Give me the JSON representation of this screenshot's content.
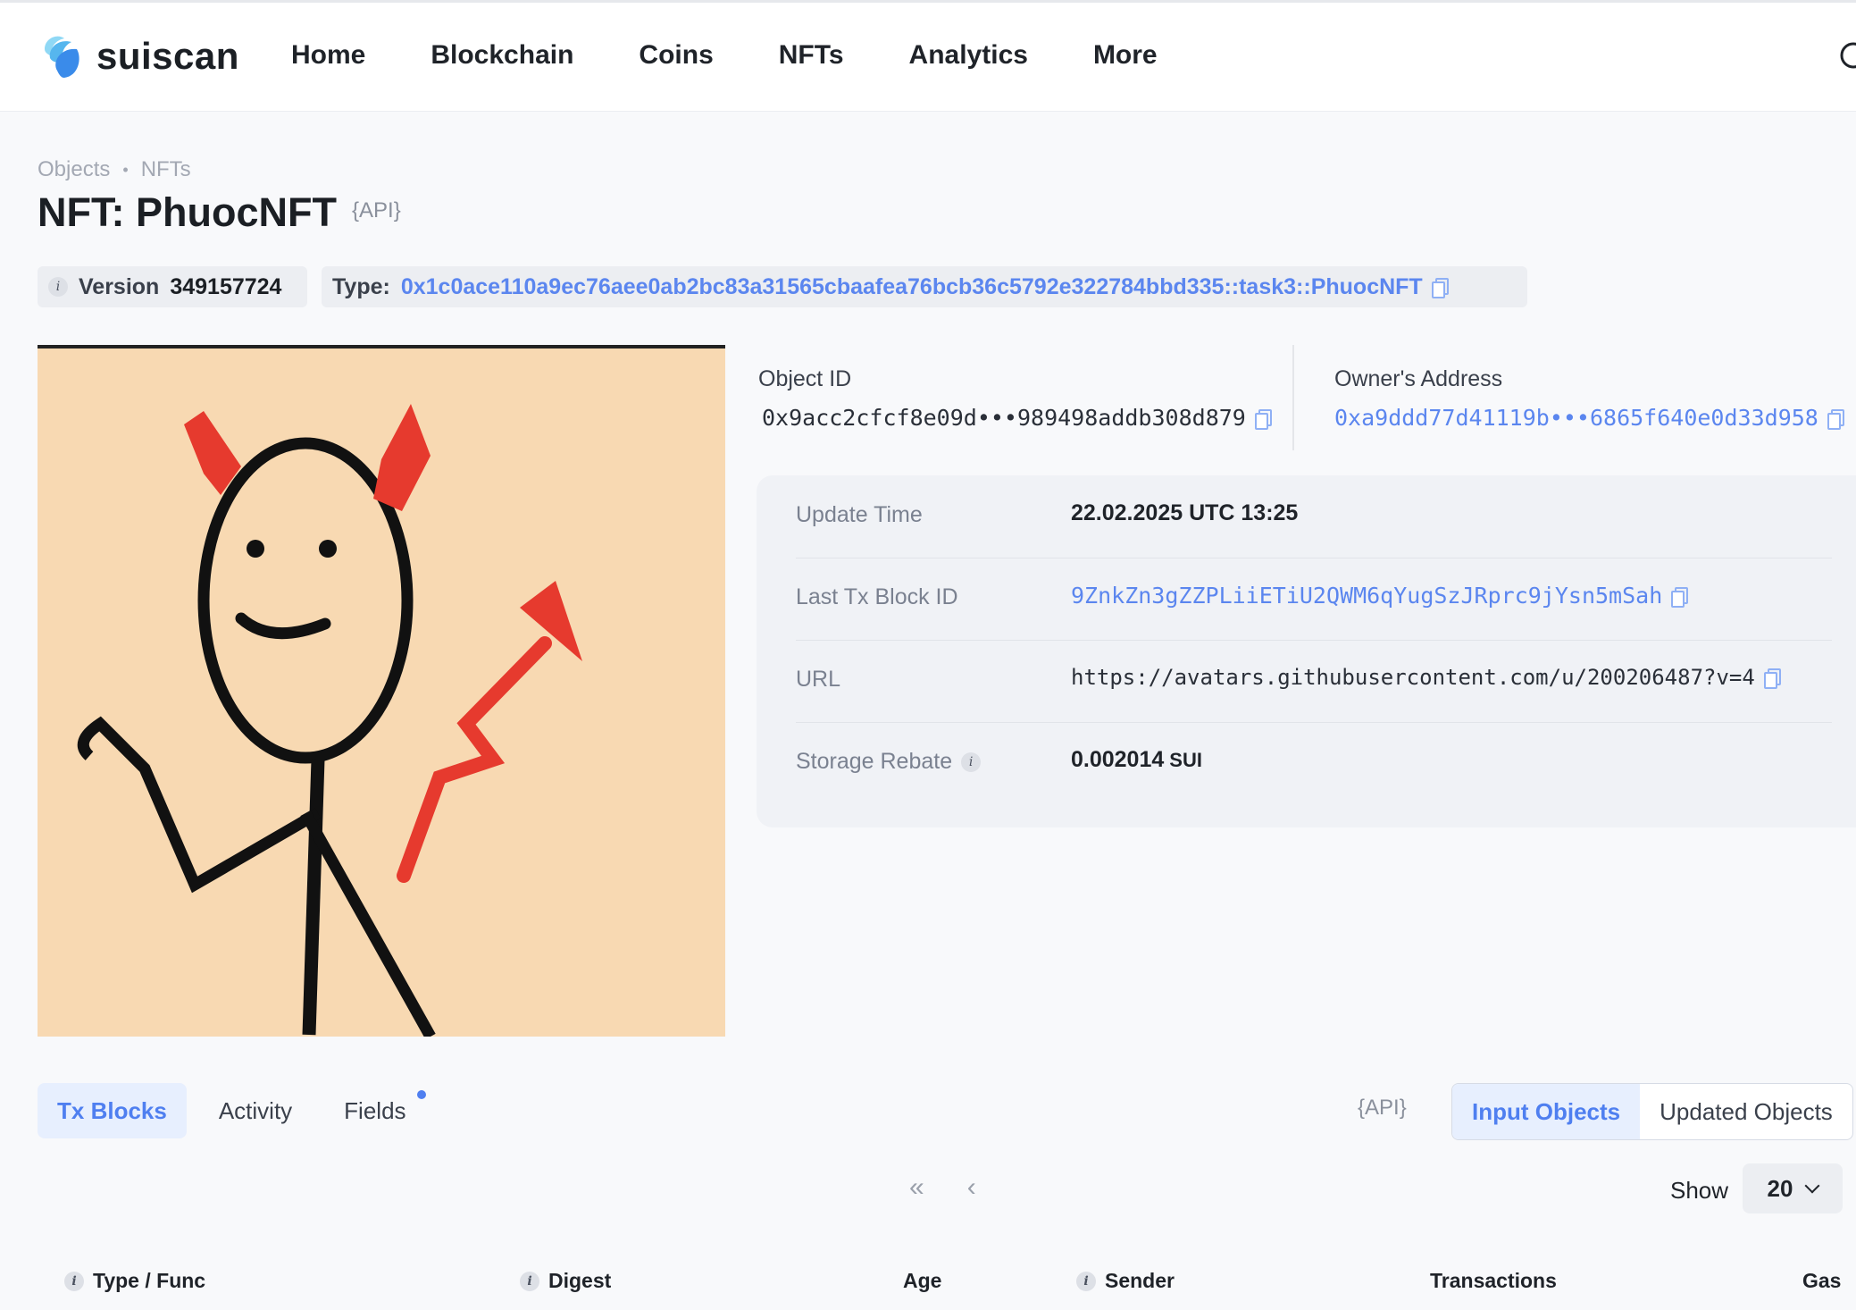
{
  "brand": {
    "name": "suiscan"
  },
  "nav": {
    "items": [
      "Home",
      "Blockchain",
      "Coins",
      "NFTs",
      "Analytics",
      "More"
    ]
  },
  "breadcrumb": [
    "Objects",
    "NFTs"
  ],
  "page": {
    "title": "NFT: PhuocNFT",
    "api_label": "API"
  },
  "version": {
    "label": "Version",
    "value": "349157724"
  },
  "type": {
    "label": "Type:",
    "value": "0x1c0ace110a9ec76aee0ab2bc83a31565cbaafea76bcb36c5792e322784bbd335::task3::PhuocNFT"
  },
  "object_id": {
    "label": "Object ID",
    "value": "0x9acc2cfcf8e09d•••989498addb308d879"
  },
  "owner": {
    "label": "Owner's Address",
    "value": "0xa9ddd77d41119b•••6865f640e0d33d958"
  },
  "details": [
    {
      "label": "Update Time",
      "value": "22.02.2025 UTC 13:25"
    },
    {
      "label": "Last Tx Block ID",
      "value": "9ZnkZn3gZZPLiiETiU2QWM6qYugSzJRprc9jYsn5mSah"
    },
    {
      "label": "URL",
      "value": "https://avatars.githubusercontent.com/u/200206487?v=4"
    },
    {
      "label": "Storage Rebate",
      "value": "0.002014",
      "unit": "SUI"
    }
  ],
  "tabs": [
    "Tx Blocks",
    "Activity",
    "Fields"
  ],
  "api_label2": "API",
  "segments": [
    "Input Objects",
    "Updated Objects"
  ],
  "pager": {
    "first": "«",
    "prev": "‹"
  },
  "show": {
    "label": "Show",
    "value": "20"
  },
  "table_headers": [
    "Type / Func",
    "Digest",
    "Age",
    "Sender",
    "Transactions",
    "Gas"
  ],
  "colors": {
    "accent": "#4f7ff0",
    "link": "#5b86ef",
    "image_bg": "#f8d9b2"
  }
}
